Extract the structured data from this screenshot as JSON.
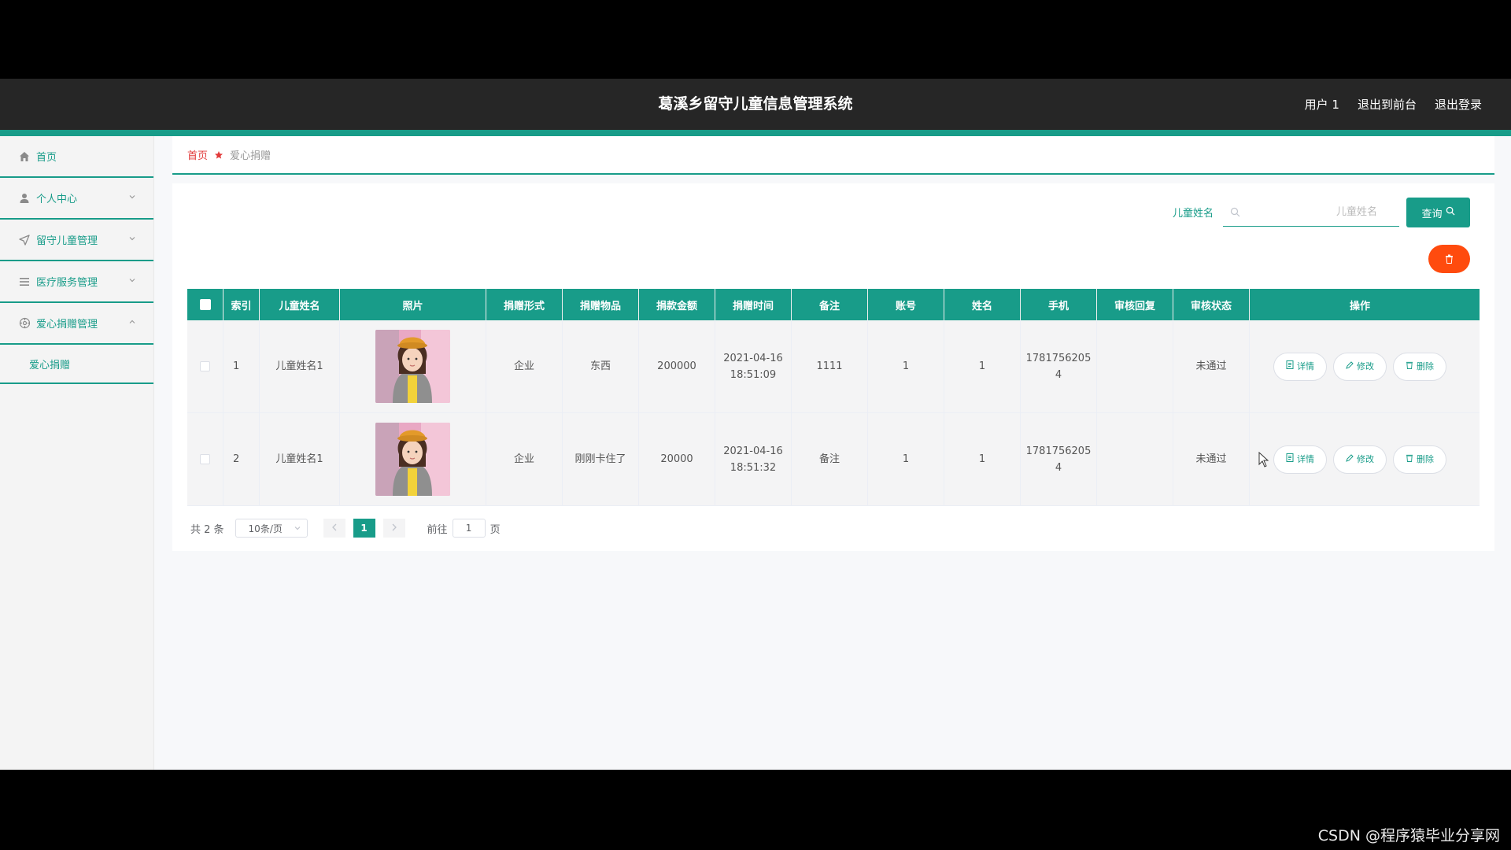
{
  "header": {
    "title": "葛溪乡留守儿童信息管理系统",
    "user": "用户 1",
    "back_to_front": "退出到前台",
    "logout": "退出登录"
  },
  "sidebar": {
    "items": [
      {
        "label": "首页",
        "icon": "home-icon"
      },
      {
        "label": "个人中心",
        "icon": "user-icon"
      },
      {
        "label": "留守儿童管理",
        "icon": "send-icon"
      },
      {
        "label": "医疗服务管理",
        "icon": "list-icon"
      },
      {
        "label": "爱心捐赠管理",
        "icon": "compass-icon"
      }
    ],
    "submenu_label": "爱心捐赠"
  },
  "breadcrumb": {
    "home": "首页",
    "current": "爱心捐赠"
  },
  "search": {
    "label": "儿童姓名",
    "placeholder": "儿童姓名",
    "value": "",
    "button": "查询"
  },
  "table": {
    "headers": [
      "索引",
      "儿童姓名",
      "照片",
      "捐赠形式",
      "捐赠物品",
      "捐款金额",
      "捐赠时间",
      "备注",
      "账号",
      "姓名",
      "手机",
      "审核回复",
      "审核状态",
      "操作"
    ],
    "rows": [
      {
        "index": "1",
        "child_name": "儿童姓名1",
        "form": "企业",
        "item": "东西",
        "amount": "200000",
        "time_date": "2021-04-16",
        "time_clock": "18:51:09",
        "note": "1111",
        "account": "1",
        "name": "1",
        "phone_a": "1781756205",
        "phone_b": "4",
        "reply": "",
        "status": "未通过"
      },
      {
        "index": "2",
        "child_name": "儿童姓名1",
        "form": "企业",
        "item": "刚刚卡住了",
        "amount": "20000",
        "time_date": "2021-04-16",
        "time_clock": "18:51:32",
        "note": "备注",
        "account": "1",
        "name": "1",
        "phone_a": "1781756205",
        "phone_b": "4",
        "reply": "",
        "status": "未通过"
      }
    ],
    "actions": {
      "detail": "详情",
      "edit": "修改",
      "delete": "删除"
    }
  },
  "pagination": {
    "total": "共 2 条",
    "page_size": "10条/页",
    "current_page": "1",
    "goto_prefix": "前往",
    "goto_value": "1",
    "goto_suffix": "页"
  },
  "watermark": "CSDN @程序猿毕业分享网",
  "colors": {
    "primary": "#189c89",
    "danger": "#ff4b0e",
    "header_bg": "#262626"
  }
}
